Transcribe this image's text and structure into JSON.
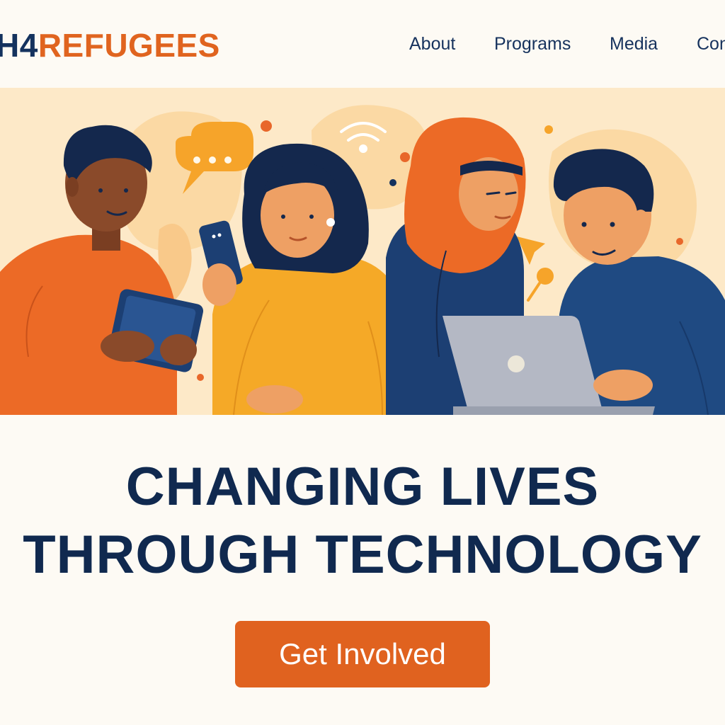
{
  "brand": {
    "logo_part1": "H4",
    "logo_part2": "REFUGEES",
    "colors": {
      "navy": "#14325e",
      "orange": "#e0641f",
      "hero_bg": "#fde9c8",
      "page_bg": "#fdfaf4"
    }
  },
  "nav": {
    "items": [
      {
        "label": "About"
      },
      {
        "label": "Programs"
      },
      {
        "label": "Media"
      },
      {
        "label": "Con"
      }
    ]
  },
  "hero": {
    "illustration": "four-people-using-devices"
  },
  "headline": {
    "line1": "CHANGING LIVES",
    "line2": "THROUGH TECHNOLOGY"
  },
  "cta": {
    "label": "Get Involved"
  }
}
